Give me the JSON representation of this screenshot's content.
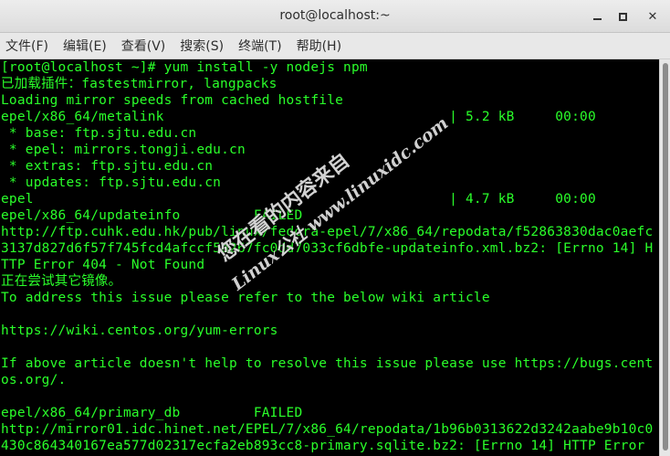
{
  "window": {
    "title": "root@localhost:~",
    "min_icon": "minimize-icon",
    "max_icon": "maximize-icon",
    "close_icon": "close-icon",
    "close_glyph": "✕"
  },
  "menu": {
    "items": [
      "文件(F)",
      "编辑(E)",
      "查看(V)",
      "搜索(S)",
      "终端(T)",
      "帮助(H)"
    ]
  },
  "terminal": {
    "text_color": "#2aff2a",
    "lines": [
      "[root@localhost ~]# yum install -y nodejs npm",
      "已加载插件：fastestmirror, langpacks",
      "Loading mirror speeds from cached hostfile",
      "epel/x86_64/metalink                                   | 5.2 kB     00:00",
      " * base: ftp.sjtu.edu.cn",
      " * epel: mirrors.tongji.edu.cn",
      " * extras: ftp.sjtu.edu.cn",
      " * updates: ftp.sjtu.edu.cn",
      "epel                                                   | 4.7 kB     00:00",
      "epel/x86_64/updateinfo         FAILED",
      "http://ftp.cuhk.edu.hk/pub/linux/fedora-epel/7/x86_64/repodata/f52863830dac0aefc",
      "3137d827d6f57f745fcd4afccf5a267fc0dd7033cf6dbfe-updateinfo.xml.bz2: [Errno 14] H",
      "TTP Error 404 - Not Found",
      "正在尝试其它镜像。",
      "To address this issue please refer to the below wiki article",
      "",
      "https://wiki.centos.org/yum-errors",
      "",
      "If above article doesn't help to resolve this issue please use https://bugs.cent",
      "os.org/.",
      "",
      "epel/x86_64/primary_db         FAILED",
      "http://mirror01.idc.hinet.net/EPEL/7/x86_64/repodata/1b96b0313622d3242aabe9b10c0",
      "430c864340167ea577d02317ecfa2eb893cc8-primary.sqlite.bz2: [Errno 14] HTTP Error"
    ]
  },
  "watermark": {
    "line1": "您在看的内容来自",
    "line2": "Linux公社 www.linuxidc.com"
  }
}
